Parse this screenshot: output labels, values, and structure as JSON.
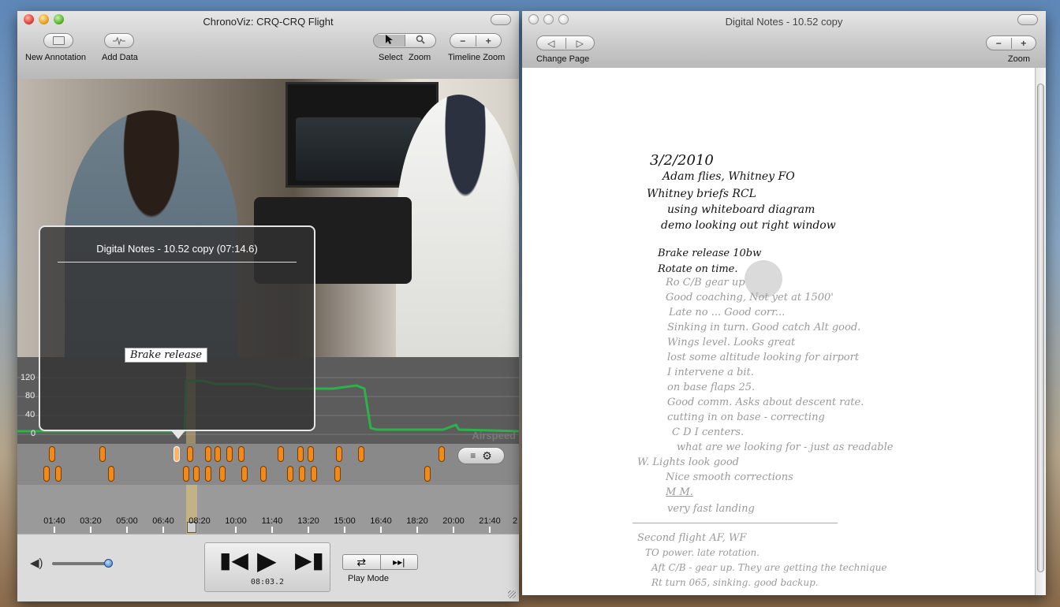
{
  "left_window": {
    "title": "ChronoViz: CRQ-CRQ Flight",
    "toolbar": {
      "new_annotation": "New Annotation",
      "add_data": "Add Data",
      "select": "Select",
      "zoom": "Zoom",
      "timeline_zoom": "Timeline Zoom"
    },
    "popup": {
      "title": "Digital Notes - 10.52 copy (07:14.6)",
      "handwriting": "Brake release"
    },
    "graph": {
      "y_ticks": [
        "120",
        "80",
        "40",
        "0"
      ],
      "label": "Airspeed"
    },
    "timeline": {
      "ticks": [
        "01:40",
        "03:20",
        "05:00",
        "06:40",
        "08:20",
        "10:00",
        "11:40",
        "13:20",
        "15:00",
        "16:40",
        "18:20",
        "20:00",
        "21:40",
        "2"
      ]
    },
    "controls": {
      "time": "08:03.2",
      "play_mode": "Play Mode",
      "volume_level": 0.75
    }
  },
  "right_window": {
    "title": "Digital Notes - 10.52 copy",
    "change_page": "Change Page",
    "zoom": "Zoom",
    "notes": [
      "3/2/2010",
      "Adam flies, Whitney FO",
      "Whitney briefs RCL",
      "using whiteboard diagram",
      "demo looking out right window",
      "Brake release 10bw",
      "Rotate on time.",
      "Ro C/B gear up",
      "Good coaching, Not yet at 1500'",
      "Late no ... Good corr...",
      "Sinking in turn. Good catch Alt good.",
      "Wings level. Looks great",
      "lost some altitude looking for airport",
      "I intervene a bit.",
      "on base flaps 25.",
      "Good comm. Asks about descent rate.",
      "cutting in on base - correcting",
      "C D I centers.",
      "what are we looking for - just as readable",
      "W. Lights look good",
      "Nice smooth corrections",
      "M M.",
      "very fast landing",
      "Second flight AF, WF",
      "TO power. late rotation.",
      "Aft C/B - gear up. They are getting the technique",
      "Rt turn 065, sinking. good backup."
    ]
  },
  "colors": {
    "airspeed_line": "#2db24a",
    "marker": "#f08a18",
    "selection": "#e7c779"
  },
  "icons": [
    "folder-icon",
    "waveform-icon",
    "arrow-cursor-icon",
    "magnifier-icon",
    "minus-icon",
    "plus-icon",
    "back-arrow-icon",
    "forward-arrow-icon",
    "volume-icon",
    "list-icon",
    "gear-icon",
    "step-back-icon",
    "play-icon",
    "step-forward-icon",
    "loop-icon",
    "step-mode-icon"
  ]
}
